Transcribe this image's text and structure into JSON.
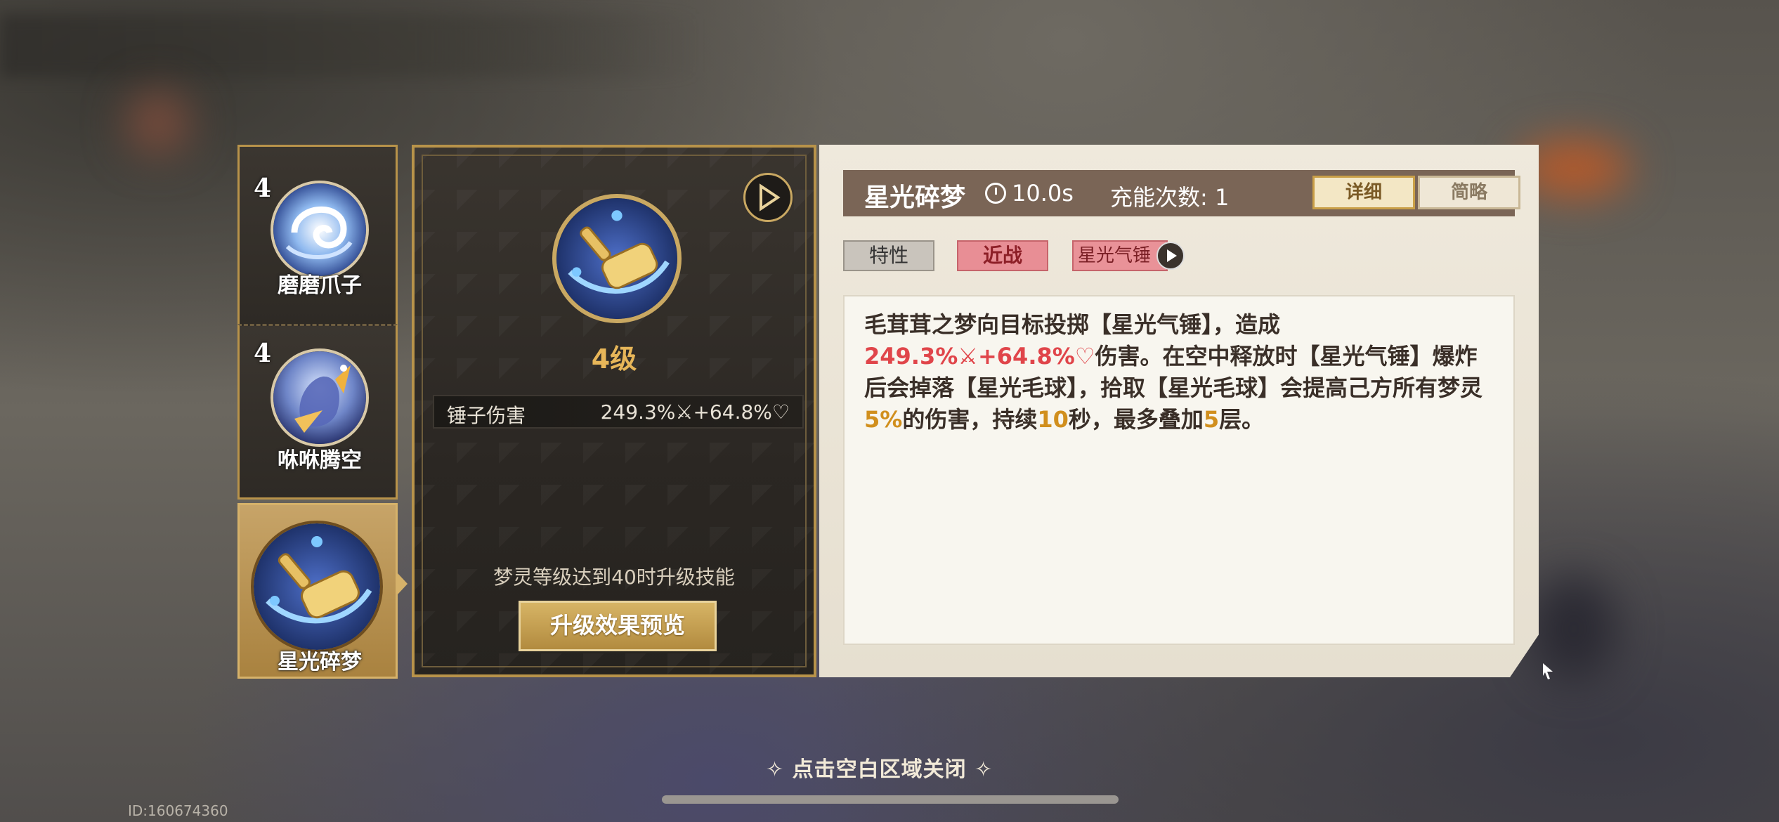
{
  "skills": [
    {
      "level": "4",
      "name": "磨磨爪子",
      "icon": "swirl-claw-icon"
    },
    {
      "level": "4",
      "name": "咻咻腾空",
      "icon": "leap-creature-icon"
    },
    {
      "level": "",
      "name": "星光碎梦",
      "icon": "golden-hammer-icon",
      "selected": true
    }
  ],
  "detail": {
    "level_text": "4级",
    "stat_label": "锤子伤害",
    "stat_value": "249.3%⚔+64.8%♡",
    "upgrade_note": "梦灵等级达到40时升级技能",
    "preview_button": "升级效果预览"
  },
  "info": {
    "title": "星光碎梦",
    "cooldown": "10.0s",
    "charges": "充能次数: 1",
    "tab_detail": "详细",
    "tab_brief": "简略",
    "tags": {
      "trait": "特性",
      "melee": "近战",
      "hammer": "星光气锤"
    },
    "desc": {
      "p1": "毛茸茸之梦向目标投掷【星光气锤】，造成",
      "dmg": "249.3%⚔+64.8%♡",
      "p2": "伤害。在空中释放时【星光气锤】爆炸后会掉落【星光毛球】，拾取【星光毛球】会提高己方所有梦灵",
      "v1": "5%",
      "p3": "的伤害，持续",
      "v2": "10",
      "p4": "秒，最多叠加",
      "v3": "5",
      "p5": "层。"
    }
  },
  "footer": {
    "hint": "✧ 点击空白区域关闭 ✧",
    "uid": "ID:160674360"
  },
  "colors": {
    "gold": "#c9a862",
    "title_bar": "#7a6556",
    "damage_red": "#e0454a",
    "highlight_gold": "#d18f1d"
  }
}
